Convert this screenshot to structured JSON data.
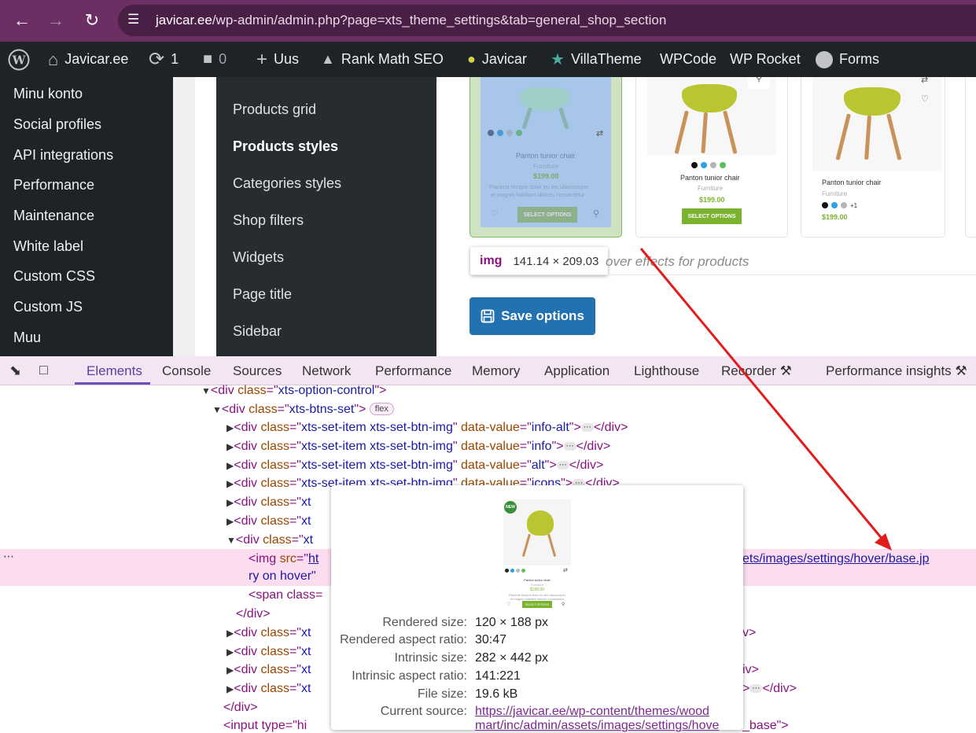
{
  "browser": {
    "url_domain": "javicar.ee",
    "url_path": "/wp-admin/admin.php?page=xts_theme_settings&tab=general_shop_section",
    "accent": "#6b2f63"
  },
  "adminbar": {
    "site_name": "Javicar.ee",
    "updates_count": "1",
    "comments_count": "0",
    "new_label": "Uus",
    "rank_math": "Rank Math SEO",
    "javicar": "Javicar",
    "villatheme": "VillaTheme",
    "wpcode": "WPCode",
    "wprocket": "WP Rocket",
    "forms": "Forms"
  },
  "left_menu": [
    "Minu konto",
    "Social profiles",
    "API integrations",
    "Performance",
    "Maintenance",
    "White label",
    "Custom CSS",
    "Custom JS",
    "Muu"
  ],
  "sub_menu": [
    "Products grid",
    "Products styles",
    "Categories styles",
    "Shop filters",
    "Widgets",
    "Page title",
    "Sidebar"
  ],
  "products": [
    {
      "name": "Panton tunior chair",
      "category": "Furniture",
      "price": "$199.00",
      "button": "SELECT OPTIONS",
      "desc1": "Placerat tempor dolor eu leo ullamcorper",
      "desc2": "et magnis habitant ultrices consectetur"
    },
    {
      "name": "Panton tunior chair",
      "category": "Furniture",
      "price": "$199.00",
      "button": "SELECT OPTIONS"
    },
    {
      "name": "Panton tunior chair",
      "category": "Furniture",
      "price": "$199.00",
      "more": "+1"
    }
  ],
  "tooltip": {
    "tag": "img",
    "dims": "141.14 × 209.03"
  },
  "hover_caption": "over effects for products",
  "save_label": "Save options",
  "devtools": {
    "tabs": [
      "Elements",
      "Console",
      "Sources",
      "Network",
      "Performance",
      "Memory",
      "Application",
      "Lighthouse",
      "Recorder",
      "Performance insights"
    ],
    "flex_badge": "flex",
    "lines": {
      "l1_class": "xts-option-control",
      "l2_class": "xts-btns-set",
      "item_class": "xts-set-item xts-set-btn-img",
      "v1": "info-alt",
      "v2": "info",
      "v3": "alt",
      "v4": "icons",
      "frag": "xt",
      "img_src_start": "ht",
      "img_src_end": "ets/images/settings/hover/base.jp",
      "img_alt": "ry on hover\"",
      "span_start": "<span class="
    }
  },
  "image_popup": {
    "thumb": {
      "badge": "NEW",
      "name": "Panton tunior chair",
      "category": "Furniture",
      "price": "$199.00",
      "desc1": "Placerat tempor dolor eu leo ullamcorper",
      "desc2": "et magnis habitant ultrices consectetur",
      "button": "SELECT OPTIONS"
    },
    "rows": [
      {
        "k": "Rendered size:",
        "v": "120 × 188 px"
      },
      {
        "k": "Rendered aspect ratio:",
        "v": "30:47"
      },
      {
        "k": "Intrinsic size:",
        "v": "282 × 442 px"
      },
      {
        "k": "Intrinsic aspect ratio:",
        "v": "141:221"
      },
      {
        "k": "File size:",
        "v": "19.6 kB"
      },
      {
        "k": "Current source:",
        "v": "https://javicar.ee/wp-content/themes/wood"
      }
    ],
    "source_line2": "mart/inc/admin/assets/images/settings/hove"
  },
  "last_line": {
    "start": "<input type=\"hi",
    "end": "_base\">"
  }
}
